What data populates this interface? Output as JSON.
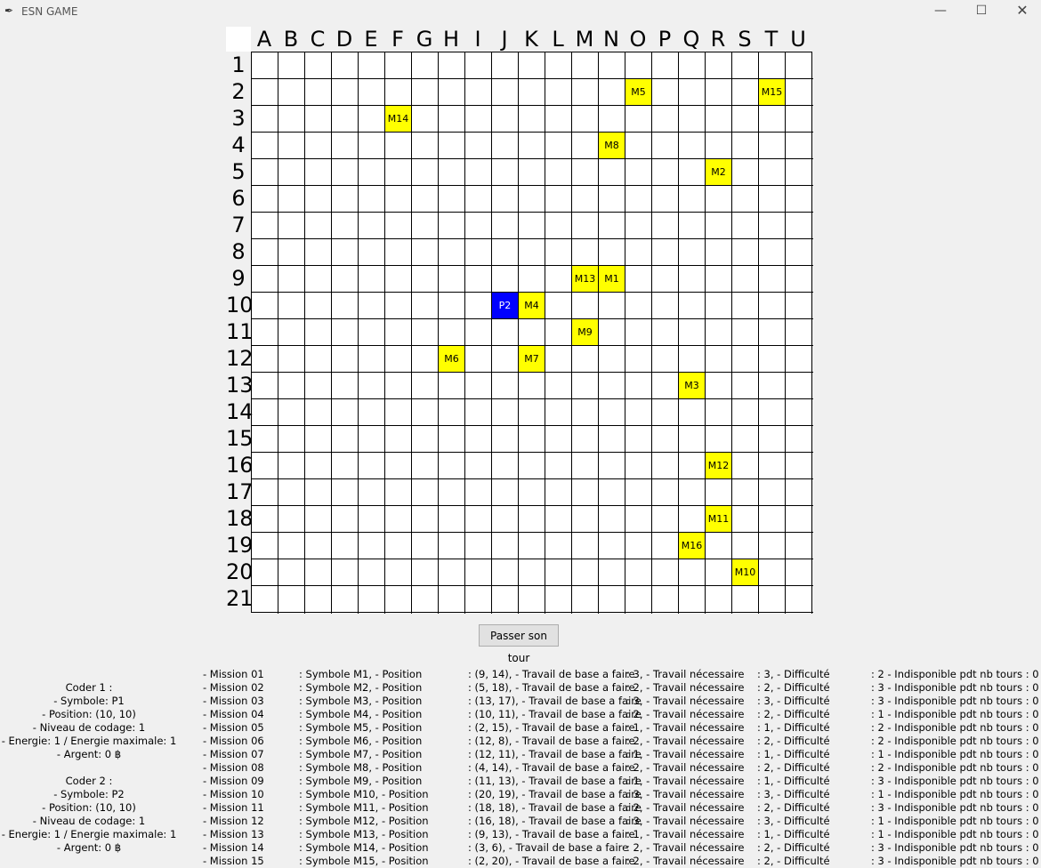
{
  "window": {
    "title": "ESN GAME",
    "icon": "feather-icon",
    "minimize_glyph": "—",
    "maximize_glyph": "☐",
    "close_glyph": "✕"
  },
  "board": {
    "columns": [
      "A",
      "B",
      "C",
      "D",
      "E",
      "F",
      "G",
      "H",
      "I",
      "J",
      "K",
      "L",
      "M",
      "N",
      "O",
      "P",
      "Q",
      "R",
      "S",
      "T",
      "U"
    ],
    "rows": [
      "1",
      "2",
      "3",
      "4",
      "5",
      "6",
      "7",
      "8",
      "9",
      "10",
      "11",
      "12",
      "13",
      "14",
      "15",
      "16",
      "17",
      "18",
      "19",
      "20",
      "21"
    ],
    "mission_color": "#ffff00",
    "player_color": "#0000ff",
    "markers": [
      {
        "label": "M5",
        "col": "O",
        "row": "2",
        "kind": "mission"
      },
      {
        "label": "M15",
        "col": "T",
        "row": "2",
        "kind": "mission"
      },
      {
        "label": "M14",
        "col": "F",
        "row": "3",
        "kind": "mission"
      },
      {
        "label": "M8",
        "col": "N",
        "row": "4",
        "kind": "mission"
      },
      {
        "label": "M2",
        "col": "R",
        "row": "5",
        "kind": "mission"
      },
      {
        "label": "M13",
        "col": "M",
        "row": "9",
        "kind": "mission"
      },
      {
        "label": "M1",
        "col": "N",
        "row": "9",
        "kind": "mission"
      },
      {
        "label": "P2",
        "col": "J",
        "row": "10",
        "kind": "player"
      },
      {
        "label": "M4",
        "col": "K",
        "row": "10",
        "kind": "mission"
      },
      {
        "label": "M9",
        "col": "M",
        "row": "11",
        "kind": "mission"
      },
      {
        "label": "M6",
        "col": "H",
        "row": "12",
        "kind": "mission"
      },
      {
        "label": "M7",
        "col": "K",
        "row": "12",
        "kind": "mission"
      },
      {
        "label": "M3",
        "col": "Q",
        "row": "13",
        "kind": "mission"
      },
      {
        "label": "M12",
        "col": "R",
        "row": "16",
        "kind": "mission"
      },
      {
        "label": "M11",
        "col": "R",
        "row": "18",
        "kind": "mission"
      },
      {
        "label": "M16",
        "col": "Q",
        "row": "19",
        "kind": "mission"
      },
      {
        "label": "M10",
        "col": "S",
        "row": "20",
        "kind": "mission"
      }
    ]
  },
  "controls": {
    "pass_turn_label": "Passer son tour"
  },
  "coders": [
    {
      "title": "Coder 1 :",
      "symbol": "- Symbole: P1",
      "position": "- Position: (10, 10)",
      "level": "- Niveau de codage: 1",
      "energy": "- Energie: 1 / Energie maximale: 1",
      "money": "- Argent: 0 ฿"
    },
    {
      "title": "Coder 2 :",
      "symbol": "- Symbole: P2",
      "position": "- Position: (10, 10)",
      "level": "- Niveau de codage: 1",
      "energy": "- Energie: 1 / Energie maximale: 1",
      "money": "- Argent: 0 ฿"
    }
  ],
  "missions": [
    {
      "id": "- Mission  01",
      "symbol": ": Symbole M1,   - Position",
      "position": ": (9, 14),   - Travail de base a faire",
      "base": ": 3,   - Travail nécessaire",
      "needed": ": 3,   - Difficulté",
      "difficulty": ": 2  - Indisponible pdt nb tours : 0"
    },
    {
      "id": "- Mission  02",
      "symbol": ": Symbole M2,   - Position",
      "position": ": (5, 18),   - Travail de base a faire",
      "base": ": 2,   - Travail nécessaire",
      "needed": ": 2,   - Difficulté",
      "difficulty": ": 3  - Indisponible pdt nb tours : 0"
    },
    {
      "id": "- Mission  03",
      "symbol": ": Symbole M3,   - Position",
      "position": ": (13, 17),   - Travail de base a faire",
      "base": ": 3,   - Travail nécessaire",
      "needed": ": 3,   - Difficulté",
      "difficulty": ": 3  - Indisponible pdt nb tours : 0"
    },
    {
      "id": "- Mission  04",
      "symbol": ": Symbole M4,   - Position",
      "position": ": (10, 11),   - Travail de base a faire",
      "base": ": 2,   - Travail nécessaire",
      "needed": ": 2,   - Difficulté",
      "difficulty": ": 1  - Indisponible pdt nb tours : 0"
    },
    {
      "id": "- Mission  05",
      "symbol": ": Symbole M5,   - Position",
      "position": ": (2, 15),   - Travail de base a faire",
      "base": ": 1,   - Travail nécessaire",
      "needed": ": 1,   - Difficulté",
      "difficulty": ": 2  - Indisponible pdt nb tours : 0"
    },
    {
      "id": "- Mission  06",
      "symbol": ": Symbole M6,   - Position",
      "position": ": (12, 8),   - Travail de base a faire",
      "base": ": 2,   - Travail nécessaire",
      "needed": ": 2,   - Difficulté",
      "difficulty": ": 2  - Indisponible pdt nb tours : 0"
    },
    {
      "id": "- Mission  07",
      "symbol": ": Symbole M7,   - Position",
      "position": ": (12, 11),   - Travail de base a faire",
      "base": ": 1,   - Travail nécessaire",
      "needed": ": 1,   - Difficulté",
      "difficulty": ": 1  - Indisponible pdt nb tours : 0"
    },
    {
      "id": "- Mission  08",
      "symbol": ": Symbole M8,   - Position",
      "position": ": (4, 14),   - Travail de base a faire",
      "base": ": 2,   - Travail nécessaire",
      "needed": ": 2,   - Difficulté",
      "difficulty": ": 2  - Indisponible pdt nb tours : 0"
    },
    {
      "id": "- Mission  09",
      "symbol": ": Symbole M9,   - Position",
      "position": ": (11, 13),   - Travail de base a faire",
      "base": ": 1,   - Travail nécessaire",
      "needed": ": 1,   - Difficulté",
      "difficulty": ": 3  - Indisponible pdt nb tours : 0"
    },
    {
      "id": "- Mission  10",
      "symbol": ": Symbole M10,   - Position",
      "position": ": (20, 19),   - Travail de base a faire",
      "base": ": 3,   - Travail nécessaire",
      "needed": ": 3,   - Difficulté",
      "difficulty": ": 1  - Indisponible pdt nb tours : 0"
    },
    {
      "id": "- Mission  11",
      "symbol": ": Symbole M11,   - Position",
      "position": ": (18, 18),   - Travail de base a faire",
      "base": ": 2,   - Travail nécessaire",
      "needed": ": 2,   - Difficulté",
      "difficulty": ": 3  - Indisponible pdt nb tours : 0"
    },
    {
      "id": "- Mission  12",
      "symbol": ": Symbole M12,   - Position",
      "position": ": (16, 18),   - Travail de base a faire",
      "base": ": 3,   - Travail nécessaire",
      "needed": ": 3,   - Difficulté",
      "difficulty": ": 1  - Indisponible pdt nb tours : 0"
    },
    {
      "id": "- Mission  13",
      "symbol": ": Symbole M13,   - Position",
      "position": ": (9, 13),   - Travail de base a faire",
      "base": ": 1,   - Travail nécessaire",
      "needed": ": 1,   - Difficulté",
      "difficulty": ": 1  - Indisponible pdt nb tours : 0"
    },
    {
      "id": "- Mission  14",
      "symbol": ": Symbole M14,   - Position",
      "position": ": (3, 6),   - Travail de base a faire",
      "base": ": 2,   - Travail nécessaire",
      "needed": ": 2,   - Difficulté",
      "difficulty": ": 3  - Indisponible pdt nb tours : 0"
    },
    {
      "id": "- Mission  15",
      "symbol": ": Symbole M15,   - Position",
      "position": ": (2, 20),   - Travail de base a faire",
      "base": ": 2,   - Travail nécessaire",
      "needed": ": 2,   - Difficulté",
      "difficulty": ": 3  - Indisponible pdt nb tours : 0"
    }
  ]
}
